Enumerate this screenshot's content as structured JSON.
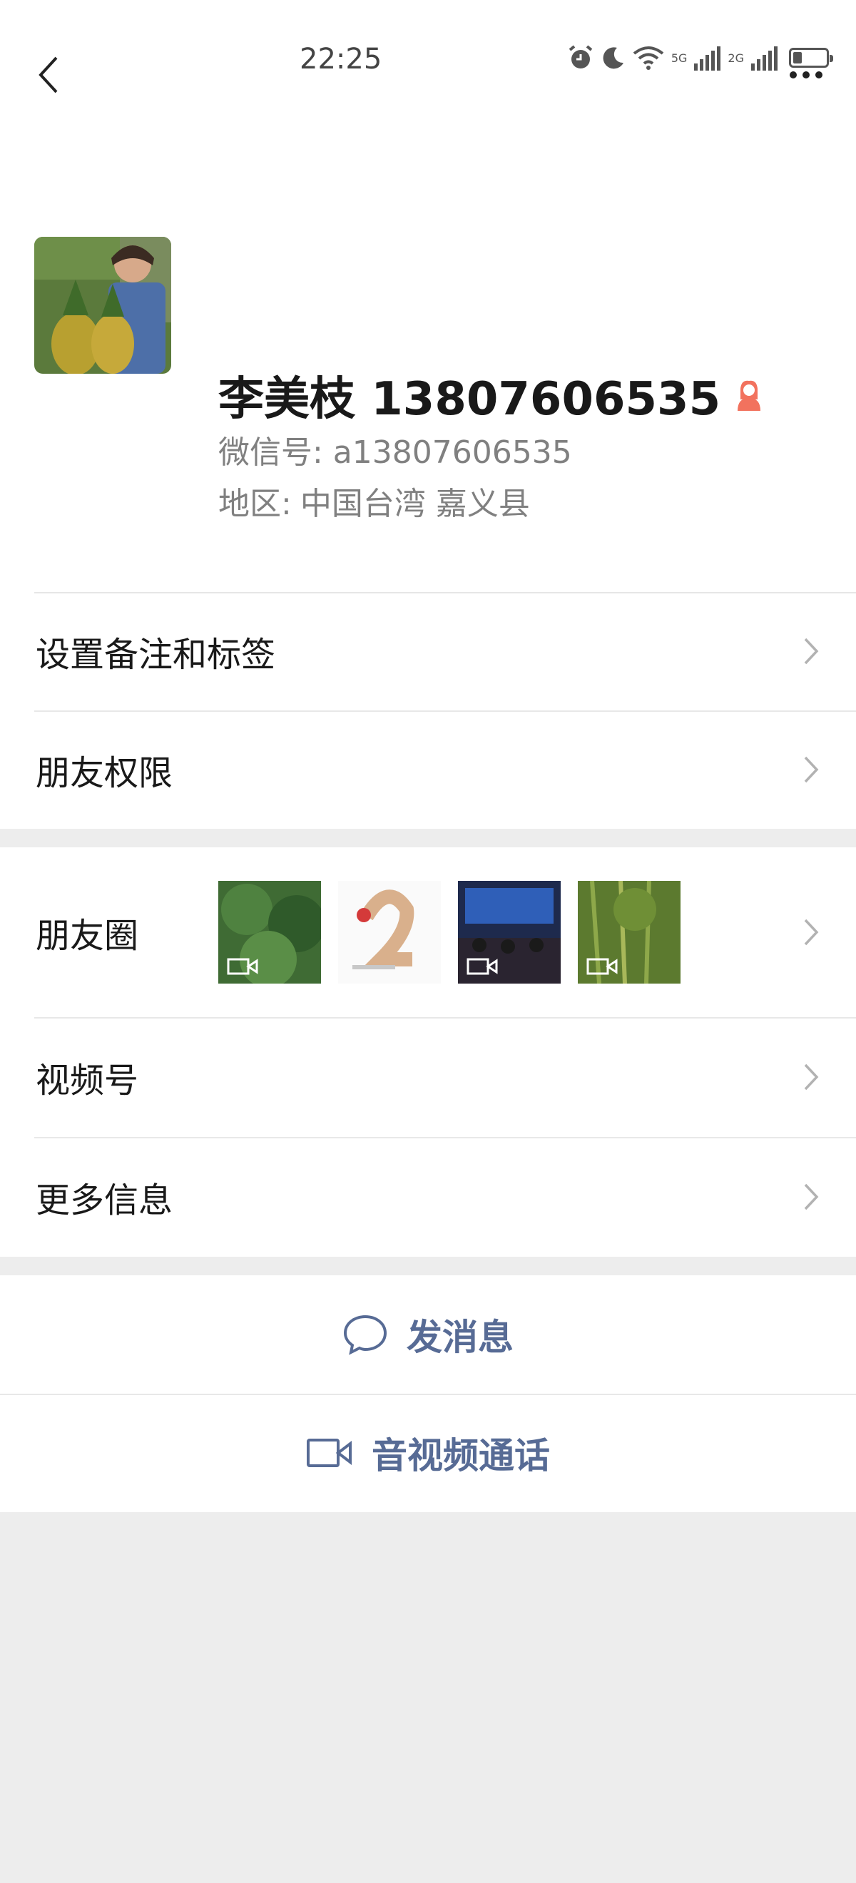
{
  "status_bar": {
    "time": "22:25",
    "network_a": "5G",
    "network_b": "2G"
  },
  "nav": {
    "back_icon": "chevron-left-icon",
    "more_icon": "more-dots-icon"
  },
  "profile": {
    "name": "李美枝 13807606535",
    "wechat_id": "微信号: a13807606535",
    "region_label": "地区:",
    "region_value": "中国台湾  嘉义县",
    "gender_icon": "female-icon",
    "gender_color": "#f2725e"
  },
  "menu_group_1": [
    {
      "label": "设置备注和标签"
    },
    {
      "label": "朋友权限"
    }
  ],
  "menu_group_2": [
    {
      "label": "朋友圈"
    },
    {
      "label": "视频号"
    },
    {
      "label": "更多信息"
    }
  ],
  "actions": [
    {
      "label": "发消息",
      "icon": "chat-bubble-icon"
    },
    {
      "label": "音视频通话",
      "icon": "video-camera-icon"
    }
  ],
  "colors": {
    "accent": "#576b95",
    "background": "#ededed"
  }
}
